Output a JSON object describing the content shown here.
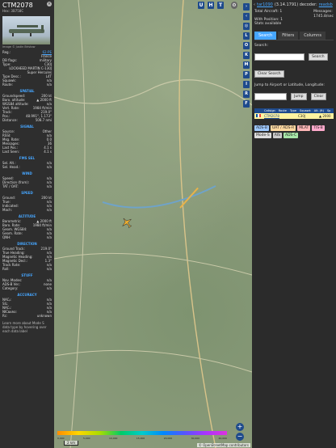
{
  "aircraft": {
    "callsign": "CTM2078",
    "hex_label": "Hex:",
    "hex": "3B758C",
    "photo_credit": "Image © Justin Bristow",
    "reg_label": "Reg.:",
    "reg": "62-PE",
    "country": "France",
    "db_flags_label": "DB flags:",
    "db_flags": "military",
    "type_label": "Type:",
    "type": "C30J",
    "type_desc_name": "LOCKHEED MARTIN C-130J Super Hercules",
    "type_desc_label": "Type Desc.:",
    "type_desc": "L4T",
    "squawk_label": "Squawk:",
    "squawk": "n/a",
    "route_label": "Route:",
    "route": "n/a"
  },
  "sections": {
    "spatial": "SPATIAL",
    "signal": "SIGNAL",
    "fms": "FMS SEL",
    "wind": "WIND",
    "speed": "SPEED",
    "altitude": "ALTITUDE",
    "direction": "DIRECTION",
    "stuff": "STUFF",
    "accuracy": "ACCURACY"
  },
  "spatial": [
    {
      "k": "Groundspeed:",
      "v": "200 kt"
    },
    {
      "k": "Baro. altitude:",
      "v": "▲ 2000 ft"
    },
    {
      "k": "WGS84 altitude:",
      "v": "n/a"
    },
    {
      "k": "Vert. Rate:",
      "v": "1984 ft/min"
    },
    {
      "k": "Track:",
      "v": "219.0°"
    },
    {
      "k": "Pos.:",
      "v": "48.991°, 1.173°"
    },
    {
      "k": "Distance:",
      "v": "508.7 nmi"
    }
  ],
  "signal": [
    {
      "k": "Source:",
      "v": "Other"
    },
    {
      "k": "RSSI:",
      "v": "n/a"
    },
    {
      "k": "Msg. Rate:",
      "v": "0.0"
    },
    {
      "k": "Messages:",
      "v": "36"
    },
    {
      "k": "Last Pos.:",
      "v": "4.1 s"
    },
    {
      "k": "Last Seen:",
      "v": "4.1 s"
    }
  ],
  "fms": [
    {
      "k": "Sel. Alt.:",
      "v": "n/a"
    },
    {
      "k": "Sel. Head.:",
      "v": "n/a"
    }
  ],
  "wind": [
    {
      "k": "Speed:",
      "v": "n/a"
    },
    {
      "k": "Direction (from):",
      "v": "n/a"
    },
    {
      "k": "TAT / OAT:",
      "v": "n/a"
    }
  ],
  "speed": [
    {
      "k": "Ground:",
      "v": "200 kt"
    },
    {
      "k": "True:",
      "v": "n/a"
    },
    {
      "k": "Indicated:",
      "v": "n/a"
    },
    {
      "k": "Mach:",
      "v": "n/a"
    }
  ],
  "altitude": [
    {
      "k": "Barometric:",
      "v": "▲ 2000 ft"
    },
    {
      "k": "Baro. Rate:",
      "v": "1984 ft/min"
    },
    {
      "k": "Geom. WGS84:",
      "v": "n/a"
    },
    {
      "k": "Geom. Rate:",
      "v": "n/a"
    },
    {
      "k": "QNH:",
      "v": "n/a"
    }
  ],
  "direction": [
    {
      "k": "Ground Track:",
      "v": "219.0°"
    },
    {
      "k": "True Heading:",
      "v": "n/a"
    },
    {
      "k": "Magnetic Heading:",
      "v": "n/a"
    },
    {
      "k": "Magnetic Decl.:",
      "v": "1.3°"
    },
    {
      "k": "Track Rate:",
      "v": "n/a"
    },
    {
      "k": "Roll:",
      "v": "n/a"
    }
  ],
  "stuff": [
    {
      "k": "Nav. Modes:",
      "v": "n/a"
    },
    {
      "k": "ADS-B Ver.:",
      "v": "none"
    },
    {
      "k": "Category:",
      "v": "n/a"
    }
  ],
  "accuracy": [
    {
      "k": "NACₚ:",
      "v": "n/a"
    },
    {
      "k": "SIL:",
      "v": "n/a"
    },
    {
      "k": "NACᵥ:",
      "v": "n/a"
    },
    {
      "k": "NICʙᴀʀᴏ:",
      "v": "n/a"
    },
    {
      "k": "Rc:",
      "v": "unknown"
    }
  ],
  "footer_note": "Learn more about Mode S data type by hovering over each data label",
  "map": {
    "buttons_top": [
      "U",
      "H",
      "T"
    ],
    "side_buttons": [
      "L",
      "O",
      "K",
      "M",
      "P",
      "I",
      "R",
      "F"
    ],
    "legend_labels": [
      "0,000",
      "5,000",
      "10,000",
      "15,000",
      "20,000",
      "30,000",
      "40,000"
    ],
    "scale": "2 km",
    "attribution": "© OpenStreetMap contributors",
    "zoom_in": "+",
    "zoom_out": "−"
  },
  "right": {
    "version_link": "tar1090",
    "version": "(3.14.1791) decoder:",
    "decoder_link": "readsb",
    "total_label": "Total Aircraft:",
    "total": "1",
    "messages_label": "Messages:",
    "messages": "1745.8/sec",
    "with_pos_label": "With Position:",
    "with_pos": "1",
    "stats": "Stats available",
    "tabs": [
      "Search",
      "Filters",
      "Columns"
    ],
    "search_label": "Search:",
    "search_btn": "Search",
    "clear_search": "Clear Search",
    "jump_label": "Jump to Airport or Latitude, Longitude:",
    "jump_btn": "Jump",
    "clear_btn": "Clear",
    "columns": [
      "Callsign",
      "Route",
      "Type",
      "Squawk",
      "Alt. (ft)",
      "Sp"
    ],
    "row": {
      "callsign": "CTM2078",
      "type": "C30J",
      "alt": "▲ 2000"
    },
    "chips": [
      {
        "label": "ADS-B",
        "color": "#9ec9ff"
      },
      {
        "label": "UAT / ADS-R",
        "color": "#ffd9a0"
      },
      {
        "label": "MLAT",
        "color": "#ffb7b7"
      },
      {
        "label": "TIS-B",
        "color": "#ffaacc"
      },
      {
        "label": "Mode-S",
        "color": "#dddddd"
      },
      {
        "label": "AIS",
        "color": "#cccccc"
      },
      {
        "label": "ADS-C",
        "color": "#a8e6a8"
      }
    ]
  }
}
